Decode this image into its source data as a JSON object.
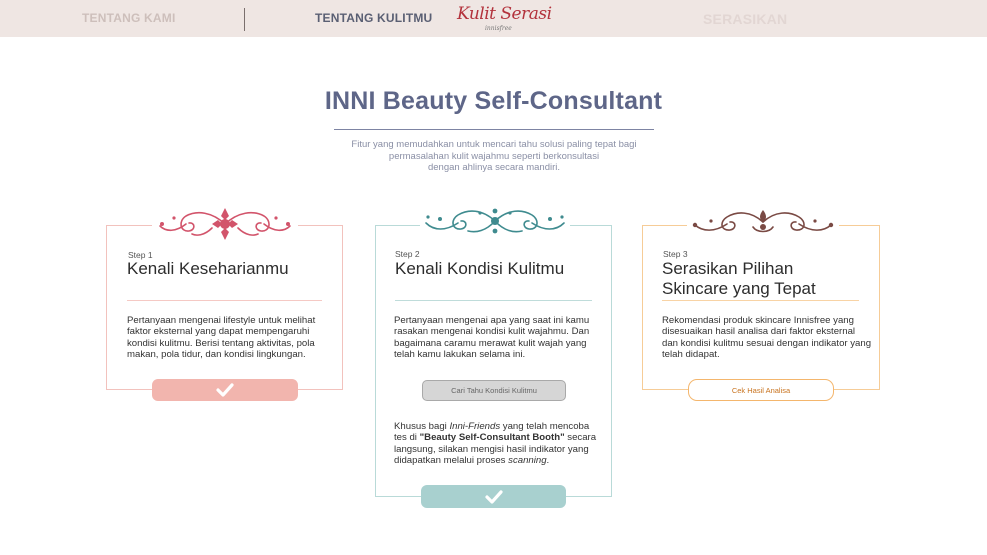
{
  "nav": {
    "tentang_kami": "TENTANG KAMI",
    "tentang_kulitmu": "TENTANG KULITMU",
    "serasikan": "SERASIKAN",
    "logo_main": "Kulit Serasi",
    "logo_sub": "innisfree"
  },
  "header": {
    "title": "INNI Beauty Self-Consultant",
    "subtitle_line1": "Fitur yang memudahkan untuk mencari tahu solusi paling tepat bagi",
    "subtitle_line2": "permasalahan kulit wajahmu seperti berkonsultasi",
    "subtitle_line3": "dengan ahlinya secara mandiri."
  },
  "steps": [
    {
      "label": "Step 1",
      "title": "Kenali Keseharianmu",
      "description": "Pertanyaan mengenai lifestyle untuk melihat faktor eksternal yang dapat mempengaruhi kondisi kulitmu. Berisi tentang aktivitas, pola makan, pola tidur, dan kondisi lingkungan."
    },
    {
      "label": "Step 2",
      "title": "Kenali Kondisi Kulitmu",
      "description": "Pertanyaan mengenai apa yang saat ini kamu rasakan mengenai kondisi kulit wajahmu. Dan bagaimana caramu merawat kulit wajah yang telah kamu lakukan selama ini.",
      "button": "Cari Tahu Kondisi Kulitmu",
      "note": {
        "p1": "Khusus bagi ",
        "em1": "Inni-Friends",
        "p2": " yang telah mencoba tes di ",
        "strong": "\"Beauty Self-Consultant Booth\"",
        "p3": " secara langsung, silakan mengisi hasil indikator yang didapatkan melalui proses ",
        "em2": "scanning",
        "p4": "."
      }
    },
    {
      "label": "Step 3",
      "title_line1": "Serasikan Pilihan",
      "title_line2": "Skincare yang Tepat",
      "description": "Rekomendasi produk skincare Innisfree yang disesuaikan hasil analisa dari faktor eksternal dan kondisi kulitmu sesuai dengan indikator yang telah didapat.",
      "button": "Cek Hasil Analisa"
    }
  ],
  "colors": {
    "step1_accent": "#f2b5ae",
    "step2_accent": "#a8d0cf",
    "step3_accent": "#f4b66d",
    "title": "#5e6688",
    "logo": "#b3323c"
  },
  "icons": {
    "step1_ornament": "floral-ornament-icon",
    "step2_ornament": "floral-ornament-icon",
    "step3_ornament": "floral-ornament-icon",
    "check": "check-icon"
  }
}
